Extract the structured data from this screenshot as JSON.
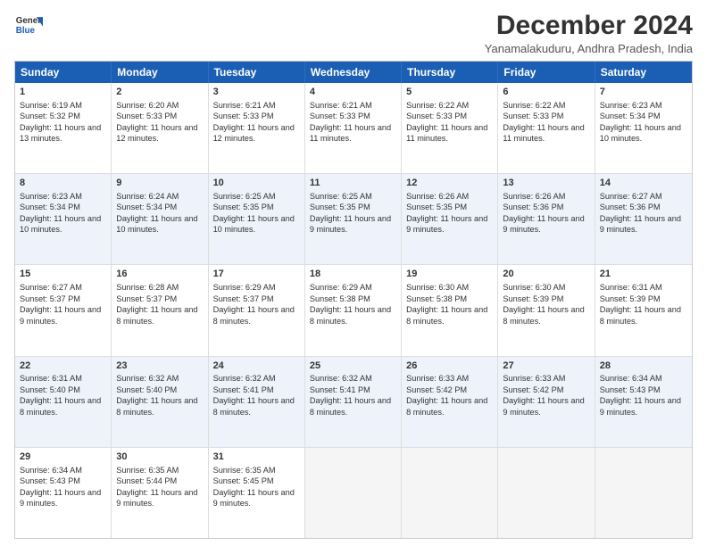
{
  "header": {
    "logo_line1": "General",
    "logo_line2": "Blue",
    "month": "December 2024",
    "location": "Yanamalakuduru, Andhra Pradesh, India"
  },
  "weekdays": [
    "Sunday",
    "Monday",
    "Tuesday",
    "Wednesday",
    "Thursday",
    "Friday",
    "Saturday"
  ],
  "weeks": [
    [
      {
        "day": "1",
        "rise": "6:19 AM",
        "set": "5:32 PM",
        "daylight": "11 hours and 13 minutes."
      },
      {
        "day": "2",
        "rise": "6:20 AM",
        "set": "5:33 PM",
        "daylight": "11 hours and 12 minutes."
      },
      {
        "day": "3",
        "rise": "6:21 AM",
        "set": "5:33 PM",
        "daylight": "11 hours and 12 minutes."
      },
      {
        "day": "4",
        "rise": "6:21 AM",
        "set": "5:33 PM",
        "daylight": "11 hours and 11 minutes."
      },
      {
        "day": "5",
        "rise": "6:22 AM",
        "set": "5:33 PM",
        "daylight": "11 hours and 11 minutes."
      },
      {
        "day": "6",
        "rise": "6:22 AM",
        "set": "5:33 PM",
        "daylight": "11 hours and 11 minutes."
      },
      {
        "day": "7",
        "rise": "6:23 AM",
        "set": "5:34 PM",
        "daylight": "11 hours and 10 minutes."
      }
    ],
    [
      {
        "day": "8",
        "rise": "6:23 AM",
        "set": "5:34 PM",
        "daylight": "11 hours and 10 minutes."
      },
      {
        "day": "9",
        "rise": "6:24 AM",
        "set": "5:34 PM",
        "daylight": "11 hours and 10 minutes."
      },
      {
        "day": "10",
        "rise": "6:25 AM",
        "set": "5:35 PM",
        "daylight": "11 hours and 10 minutes."
      },
      {
        "day": "11",
        "rise": "6:25 AM",
        "set": "5:35 PM",
        "daylight": "11 hours and 9 minutes."
      },
      {
        "day": "12",
        "rise": "6:26 AM",
        "set": "5:35 PM",
        "daylight": "11 hours and 9 minutes."
      },
      {
        "day": "13",
        "rise": "6:26 AM",
        "set": "5:36 PM",
        "daylight": "11 hours and 9 minutes."
      },
      {
        "day": "14",
        "rise": "6:27 AM",
        "set": "5:36 PM",
        "daylight": "11 hours and 9 minutes."
      }
    ],
    [
      {
        "day": "15",
        "rise": "6:27 AM",
        "set": "5:37 PM",
        "daylight": "11 hours and 9 minutes."
      },
      {
        "day": "16",
        "rise": "6:28 AM",
        "set": "5:37 PM",
        "daylight": "11 hours and 8 minutes."
      },
      {
        "day": "17",
        "rise": "6:29 AM",
        "set": "5:37 PM",
        "daylight": "11 hours and 8 minutes."
      },
      {
        "day": "18",
        "rise": "6:29 AM",
        "set": "5:38 PM",
        "daylight": "11 hours and 8 minutes."
      },
      {
        "day": "19",
        "rise": "6:30 AM",
        "set": "5:38 PM",
        "daylight": "11 hours and 8 minutes."
      },
      {
        "day": "20",
        "rise": "6:30 AM",
        "set": "5:39 PM",
        "daylight": "11 hours and 8 minutes."
      },
      {
        "day": "21",
        "rise": "6:31 AM",
        "set": "5:39 PM",
        "daylight": "11 hours and 8 minutes."
      }
    ],
    [
      {
        "day": "22",
        "rise": "6:31 AM",
        "set": "5:40 PM",
        "daylight": "11 hours and 8 minutes."
      },
      {
        "day": "23",
        "rise": "6:32 AM",
        "set": "5:40 PM",
        "daylight": "11 hours and 8 minutes."
      },
      {
        "day": "24",
        "rise": "6:32 AM",
        "set": "5:41 PM",
        "daylight": "11 hours and 8 minutes."
      },
      {
        "day": "25",
        "rise": "6:32 AM",
        "set": "5:41 PM",
        "daylight": "11 hours and 8 minutes."
      },
      {
        "day": "26",
        "rise": "6:33 AM",
        "set": "5:42 PM",
        "daylight": "11 hours and 8 minutes."
      },
      {
        "day": "27",
        "rise": "6:33 AM",
        "set": "5:42 PM",
        "daylight": "11 hours and 9 minutes."
      },
      {
        "day": "28",
        "rise": "6:34 AM",
        "set": "5:43 PM",
        "daylight": "11 hours and 9 minutes."
      }
    ],
    [
      {
        "day": "29",
        "rise": "6:34 AM",
        "set": "5:43 PM",
        "daylight": "11 hours and 9 minutes."
      },
      {
        "day": "30",
        "rise": "6:35 AM",
        "set": "5:44 PM",
        "daylight": "11 hours and 9 minutes."
      },
      {
        "day": "31",
        "rise": "6:35 AM",
        "set": "5:45 PM",
        "daylight": "11 hours and 9 minutes."
      },
      null,
      null,
      null,
      null
    ]
  ]
}
